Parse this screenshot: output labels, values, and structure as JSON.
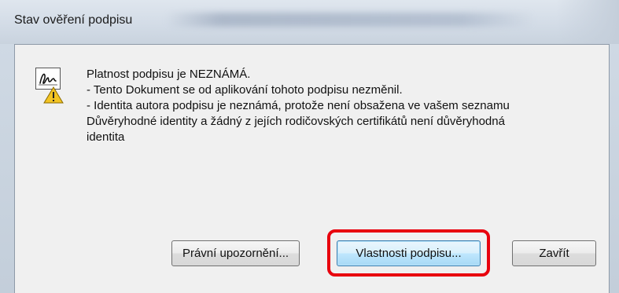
{
  "window": {
    "title": "Stav ověření podpisu"
  },
  "status_icon": "signature-warning-icon",
  "message": {
    "heading": "Platnost podpisu je NEZNÁMÁ.",
    "line1": "- Tento Dokument se od aplikování tohoto podpisu nezměnil.",
    "line2": "- Identita autora podpisu je neznámá, protože není obsažena ve vašem seznamu",
    "line3": "Důvěryhodné identity a žádný z jejích rodičovských certifikátů není důvěryhodná",
    "line4": "identita"
  },
  "buttons": {
    "legal_notice": "Právní upozornění...",
    "signature_properties": "Vlastnosti podpisu...",
    "close": "Zavřít"
  },
  "colors": {
    "highlight": "#e8000e",
    "dialog_bg": "#f0f0f0",
    "titlebar": "#d2dbe6"
  }
}
